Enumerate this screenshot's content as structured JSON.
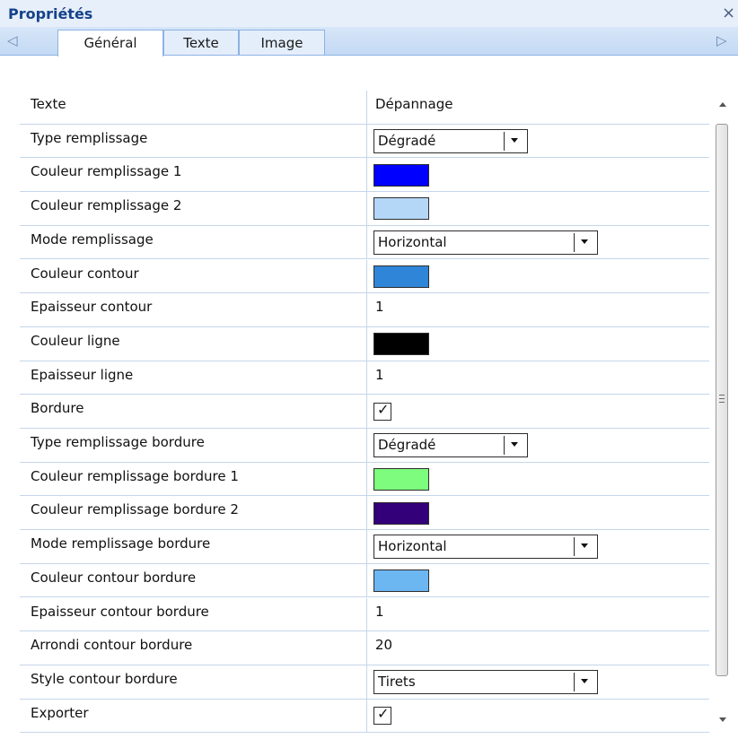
{
  "panel": {
    "title": "Propriétés",
    "close": "×"
  },
  "tabs": {
    "left_arrow": "◁",
    "right_arrow": "▷",
    "items": [
      {
        "label": "Général",
        "active": true
      },
      {
        "label": "Texte",
        "active": false
      },
      {
        "label": "Image",
        "active": false
      }
    ]
  },
  "properties": [
    {
      "name": "Texte",
      "type": "text",
      "value": "Dépannage"
    },
    {
      "name": "Type remplissage",
      "type": "select",
      "value": "Dégradé"
    },
    {
      "name": "Couleur remplissage 1",
      "type": "color",
      "color": "#0000ff"
    },
    {
      "name": "Couleur remplissage 2",
      "type": "color",
      "color": "#b4d7f8"
    },
    {
      "name": "Mode remplissage",
      "type": "select",
      "value": "Horizontal"
    },
    {
      "name": "Couleur contour",
      "type": "color",
      "color": "#2f86d8"
    },
    {
      "name": "Epaisseur contour",
      "type": "text",
      "value": "1"
    },
    {
      "name": "Couleur ligne",
      "type": "color",
      "color": "#000000"
    },
    {
      "name": "Epaisseur ligne",
      "type": "text",
      "value": "1"
    },
    {
      "name": "Bordure",
      "type": "checkbox",
      "checked": true
    },
    {
      "name": "Type remplissage bordure",
      "type": "select",
      "value": "Dégradé"
    },
    {
      "name": "Couleur remplissage bordure 1",
      "type": "color",
      "color": "#7dfc7d"
    },
    {
      "name": "Couleur remplissage bordure 2",
      "type": "color",
      "color": "#33007a"
    },
    {
      "name": "Mode remplissage bordure",
      "type": "select",
      "value": "Horizontal"
    },
    {
      "name": "Couleur contour bordure",
      "type": "color",
      "color": "#6cb6f2"
    },
    {
      "name": "Epaisseur contour bordure",
      "type": "text",
      "value": "1"
    },
    {
      "name": "Arrondi contour bordure",
      "type": "text",
      "value": "20"
    },
    {
      "name": "Style contour bordure",
      "type": "select",
      "value": "Tirets"
    },
    {
      "name": "Exporter",
      "type": "checkbox",
      "checked": true
    }
  ]
}
